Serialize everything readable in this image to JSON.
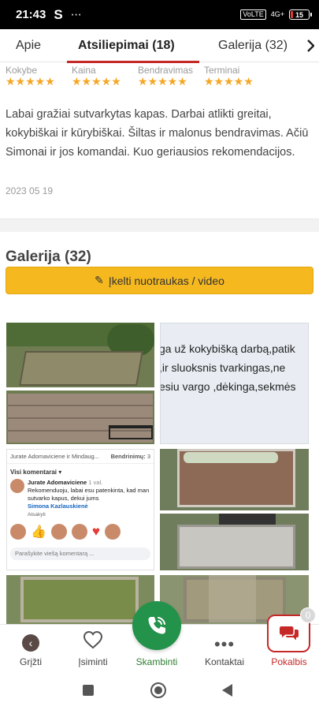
{
  "status": {
    "time": "21:43",
    "app_letter": "S",
    "dots": "⋯",
    "volte": "VoLTE",
    "network": "4G+",
    "battery": "15",
    "battery_level": 0.15
  },
  "tabs": [
    {
      "label": "Apie",
      "active": false
    },
    {
      "label": "Atsiliepimai (18)",
      "active": true
    },
    {
      "label": "Galerija (32)",
      "active": false
    }
  ],
  "review": {
    "ratings": [
      {
        "label": "Kokybe",
        "stars": "★★★★★",
        "value": 5
      },
      {
        "label": "Kaina",
        "stars": "★★★★★",
        "value": 5
      },
      {
        "label": "Bendravimas",
        "stars": "★★★★★",
        "value": 5
      },
      {
        "label": "Terminai",
        "stars": "★★★★★",
        "value": 5
      }
    ],
    "text": "Labai gražiai sutvarkytas kapas. Darbai atlikti greitai, kokybiškai ir kūrybiškai. Šiltas ir malonus bendravimas. Ačiū Simonai ir jos komandai. Kuo geriausios rekomendacijos.",
    "date": "2023 05 19"
  },
  "gallery": {
    "title": "Galerija (32)",
    "upload_label": "Įkelti nuotraukas / video",
    "text_thumb_lines": [
      "ga už kokybišką darbą,patik",
      ",ir sluoksnis tvarkingas,ne",
      "esiu vargo ,dėkinga,sekmės"
    ],
    "fb": {
      "header_left": "Jurate Adomaviciene ir Mindaug...",
      "header_right_label": "Bendrinimų:",
      "header_right_count": "3",
      "sort": "Visi komentarai ▾",
      "name": "Jurate Adomaviciene",
      "time": "1 val.",
      "comment": "Rekomenduoju, labai esu patenkinta, kad man sutvarko kapus, dekui jums",
      "mention": "Simona Kazlauskienė",
      "reply": "Atsakyti",
      "input_placeholder": "Parašykite viešą komentarą ..."
    }
  },
  "bottom_nav": {
    "back": "Grįžti",
    "remember": "Įsiminti",
    "call": "Skambinti",
    "contacts": "Kontaktai",
    "chat": "Pokalbis",
    "chat_badge": "0"
  },
  "colors": {
    "accent_red": "#c62828",
    "upload_yellow": "#f5b81e",
    "call_green": "#23924a",
    "star": "#f5a623"
  }
}
